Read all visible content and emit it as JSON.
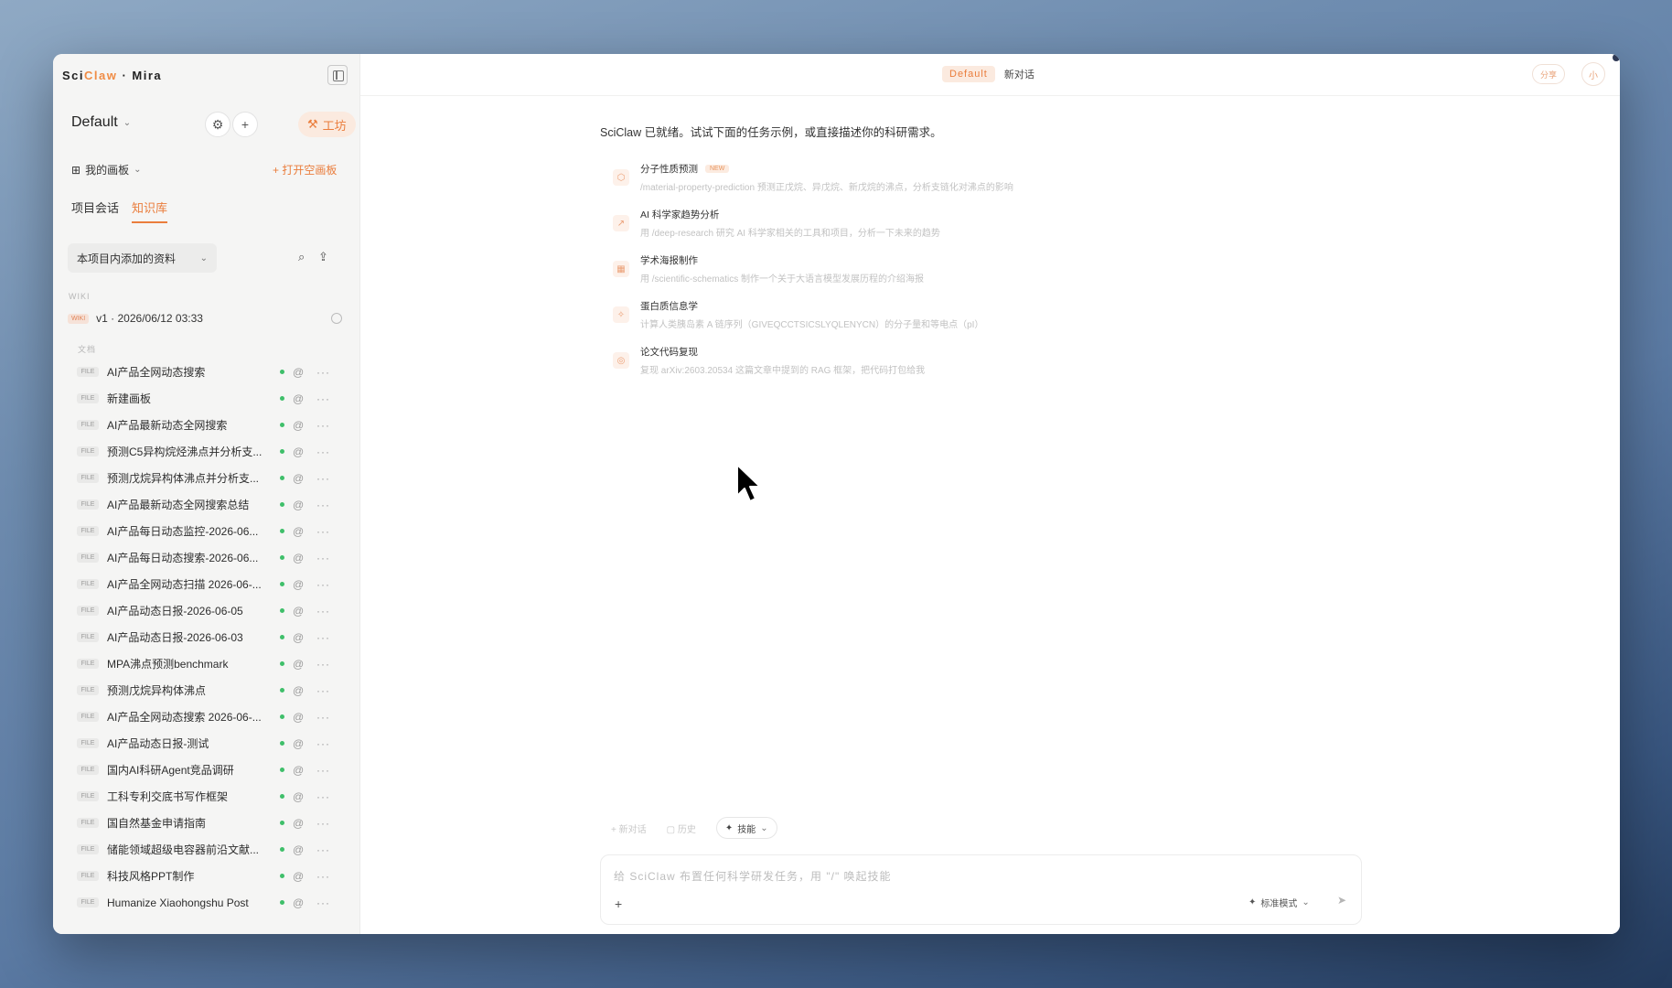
{
  "brand": {
    "prefix": "Sci",
    "accent": "Claw",
    "suffix": " · Mira"
  },
  "sidebar": {
    "project": "Default",
    "workshop_label": "工坊",
    "board_label": "我的画板",
    "open_board_label": "+ 打开空画板",
    "tabs": [
      {
        "label": "项目会话",
        "active": false
      },
      {
        "label": "知识库",
        "active": true
      }
    ],
    "kb_select": "本项目内添加的资料",
    "wiki_label": "WIKI",
    "version": {
      "badge": "WIKI",
      "label": "v1 · 2026/06/12 03:33"
    },
    "docs_label": "文档",
    "file_badge": "FILE",
    "files": [
      "AI产品全网动态搜索",
      "新建画板",
      "AI产品最新动态全网搜索",
      "预测C5异构烷烃沸点并分析支...",
      "预测戊烷异构体沸点并分析支...",
      "AI产品最新动态全网搜索总结",
      "AI产品每日动态监控-2026-06...",
      "AI产品每日动态搜索-2026-06...",
      "AI产品全网动态扫描 2026-06-...",
      "AI产品动态日报-2026-06-05",
      "AI产品动态日报-2026-06-03",
      "MPA沸点预测benchmark",
      "预测戊烷异构体沸点",
      "AI产品全网动态搜索 2026-06-...",
      "AI产品动态日报-测试",
      "国内AI科研Agent竞品调研",
      "工科专利交底书写作框架",
      "国自然基金申请指南",
      "储能领域超级电容器前沿文献...",
      "科技风格PPT制作",
      "Humanize Xiaohongshu Post"
    ]
  },
  "topbar": {
    "pill": "Default",
    "title": "新对话",
    "right_label": "分享",
    "right2_label": "小"
  },
  "main": {
    "ready_message": "SciClaw 已就绪。试试下面的任务示例，或直接描述你的科研需求。",
    "new_badge": "NEW",
    "examples": [
      {
        "title": "分子性质预测",
        "desc": "/material-property-prediction 预测正戊烷、异戊烷、新戊烷的沸点，分析支链化对沸点的影响",
        "is_new": true,
        "icon": "molecule-icon"
      },
      {
        "title": "AI 科学家趋势分析",
        "desc": "用 /deep-research 研究 AI 科学家相关的工具和项目，分析一下未来的趋势",
        "is_new": false,
        "icon": "trend-icon"
      },
      {
        "title": "学术海报制作",
        "desc": "用 /scientific-schematics 制作一个关于大语言模型发展历程的介绍海报",
        "is_new": false,
        "icon": "poster-icon"
      },
      {
        "title": "蛋白质信息学",
        "desc": "计算人类胰岛素 A 链序列（GIVEQCCTSICSLYQLENYCN）的分子量和等电点（pI）",
        "is_new": false,
        "icon": "protein-icon"
      },
      {
        "title": "论文代码复现",
        "desc": "复现 arXiv:2603.20534 这篇文章中提到的 RAG 框架，把代码打包给我",
        "is_new": false,
        "icon": "code-icon"
      }
    ],
    "tools": {
      "new_chat": "+ 新对话",
      "history": "历史",
      "skills": "技能"
    },
    "composer": {
      "placeholder": "给 SciClaw 布置任何科学研发任务，用 \"/\" 唤起技能",
      "mode": "标准模式"
    }
  },
  "colors": {
    "accent": "#ea7d3c",
    "status_green": "#3fbf6a"
  }
}
